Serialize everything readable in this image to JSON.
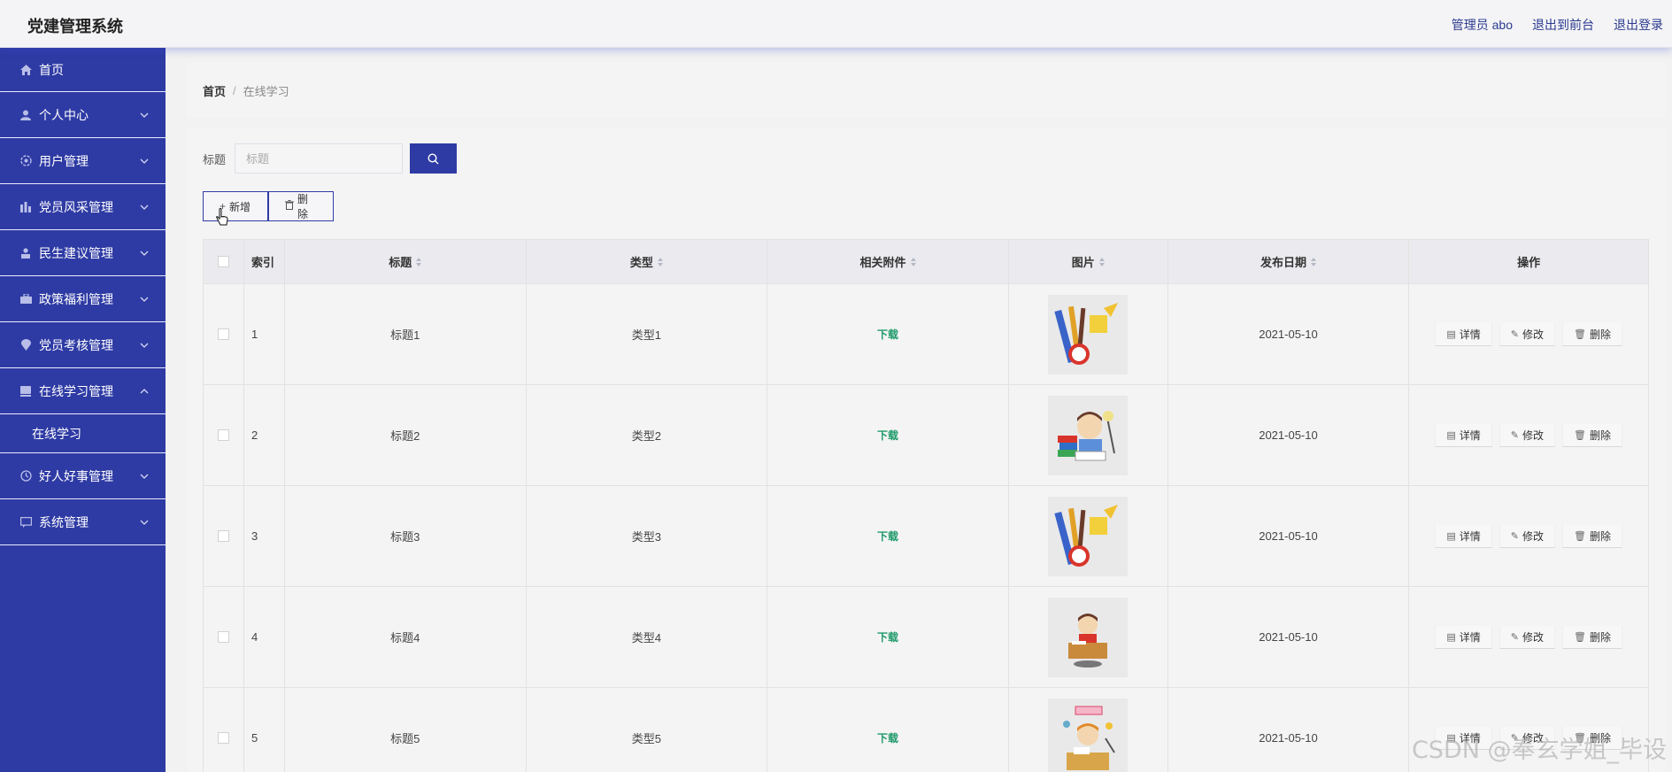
{
  "app": {
    "title": "党建管理系统"
  },
  "topbar": {
    "user_label": "管理员 abo",
    "front_label": "退出到前台",
    "logout_label": "退出登录"
  },
  "sidebar": {
    "items": [
      {
        "label": "首页",
        "icon": "home-icon"
      },
      {
        "label": "个人中心",
        "icon": "user-icon"
      },
      {
        "label": "用户管理",
        "icon": "gear-icon"
      },
      {
        "label": "党员风采管理",
        "icon": "chart-icon"
      },
      {
        "label": "民生建议管理",
        "icon": "person-icon"
      },
      {
        "label": "政策福利管理",
        "icon": "briefcase-icon"
      },
      {
        "label": "党员考核管理",
        "icon": "pin-icon"
      },
      {
        "label": "在线学习管理",
        "icon": "book-icon"
      },
      {
        "label": "好人好事管理",
        "icon": "clock-icon"
      },
      {
        "label": "系统管理",
        "icon": "message-icon"
      }
    ],
    "submenu": {
      "label": "在线学习"
    }
  },
  "breadcrumb": {
    "home": "首页",
    "separator": "/",
    "current": "在线学习"
  },
  "search": {
    "label": "标题",
    "placeholder": "标题"
  },
  "actions": {
    "add_label": "新增",
    "delete_label": "删除"
  },
  "table": {
    "headers": {
      "index": "索引",
      "title": "标题",
      "type": "类型",
      "attachment": "相关附件",
      "image": "图片",
      "date": "发布日期",
      "ops": "操作"
    },
    "rows": [
      {
        "index": "1",
        "title": "标题1",
        "type": "类型1",
        "attachment": "下载",
        "image": "stationery-image",
        "date": "2021-05-10"
      },
      {
        "index": "2",
        "title": "标题2",
        "type": "类型2",
        "attachment": "下载",
        "image": "reading-student-image",
        "date": "2021-05-10"
      },
      {
        "index": "3",
        "title": "标题3",
        "type": "类型3",
        "attachment": "下载",
        "image": "stationery-image",
        "date": "2021-05-10"
      },
      {
        "index": "4",
        "title": "标题4",
        "type": "类型4",
        "attachment": "下载",
        "image": "desk-student-image",
        "date": "2021-05-10"
      },
      {
        "index": "5",
        "title": "标题5",
        "type": "类型5",
        "attachment": "下载",
        "image": "study-student-image",
        "date": "2021-05-10"
      }
    ],
    "op_labels": {
      "detail": "详情",
      "edit": "修改",
      "delete": "删除"
    }
  },
  "watermark": "CSDN @奉玄学姐_毕设",
  "colors": {
    "sidebar": "#2f3ba4",
    "accent": "#2f3ba4",
    "download": "#1f9a6b"
  }
}
